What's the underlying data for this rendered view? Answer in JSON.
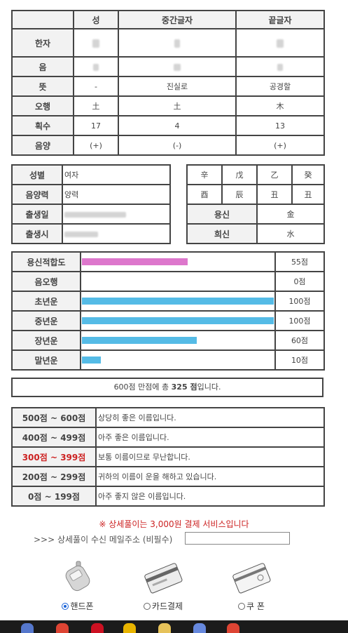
{
  "name_table": {
    "headers": [
      "",
      "성",
      "중간글자",
      "끝글자"
    ],
    "rows": [
      {
        "label": "한자",
        "values": [
          "",
          "",
          ""
        ]
      },
      {
        "label": "음",
        "values": [
          "",
          "",
          ""
        ]
      },
      {
        "label": "뜻",
        "values": [
          "-",
          "진실로",
          "공경할"
        ]
      },
      {
        "label": "오행",
        "values": [
          "土",
          "土",
          "木"
        ]
      },
      {
        "label": "획수",
        "values": [
          "17",
          "4",
          "13"
        ]
      },
      {
        "label": "음양",
        "values": [
          "(+)",
          "(-)",
          "(+)"
        ]
      }
    ]
  },
  "info": {
    "gender_label": "성별",
    "gender_value": "여자",
    "calendar_label": "음양력",
    "calendar_value": "양력",
    "birthdate_label": "출생일",
    "birthtime_label": "출생시"
  },
  "saju": {
    "row1": [
      "辛",
      "戊",
      "乙",
      "癸"
    ],
    "row2": [
      "酉",
      "辰",
      "丑",
      "丑"
    ],
    "yongsin_label": "용신",
    "yongsin_value": "金",
    "huisin_label": "희신",
    "huisin_value": "水"
  },
  "scores": {
    "max": 100,
    "rows": [
      {
        "label": "용신적합도",
        "value": 55,
        "display": "55점",
        "color": "#dd77cc"
      },
      {
        "label": "음오행",
        "value": 0,
        "display": "0점",
        "color": "#55bbe6"
      },
      {
        "label": "초년운",
        "value": 100,
        "display": "100점",
        "color": "#55bbe6"
      },
      {
        "label": "중년운",
        "value": 100,
        "display": "100점",
        "color": "#55bbe6"
      },
      {
        "label": "장년운",
        "value": 60,
        "display": "60점",
        "color": "#55bbe6"
      },
      {
        "label": "말년운",
        "value": 10,
        "display": "10점",
        "color": "#55bbe6"
      }
    ]
  },
  "total": {
    "prefix": "600점 만점에 총 ",
    "score": "325",
    "unit": " 점",
    "suffix": "입니다."
  },
  "grades": [
    {
      "range": "500점 ~ 600점",
      "desc": "상당히 좋은 이름입니다.",
      "highlight": false
    },
    {
      "range": "400점 ~ 499점",
      "desc": "아주 좋은 이름입니다.",
      "highlight": false
    },
    {
      "range": "300점 ~ 399점",
      "desc": "보통 이름이므로 무난합니다.",
      "highlight": true
    },
    {
      "range": "200점 ~ 299점",
      "desc": "귀하의 이름이 운을 해하고 있습니다.",
      "highlight": false
    },
    {
      "range": "0점 ~ 199점",
      "desc": "아주 좋지 않은 이름입니다.",
      "highlight": false
    }
  ],
  "notice": "※ 상세풀이는 3,000원 결제 서비스입니다",
  "email": {
    "label": ">>> 상세풀이 수신 메일주소 (비필수)",
    "value": ""
  },
  "payment": [
    {
      "label": "핸드폰",
      "selected": true,
      "icon": "phone-icon"
    },
    {
      "label": "카드결제",
      "selected": false,
      "icon": "card-icon"
    },
    {
      "label": "쿠 폰",
      "selected": false,
      "icon": "coupon-icon"
    }
  ],
  "colors": {
    "highlight": "#cc2222",
    "pink_bar": "#dd77cc",
    "blue_bar": "#55bbe6",
    "radio": "#1a63d8"
  }
}
